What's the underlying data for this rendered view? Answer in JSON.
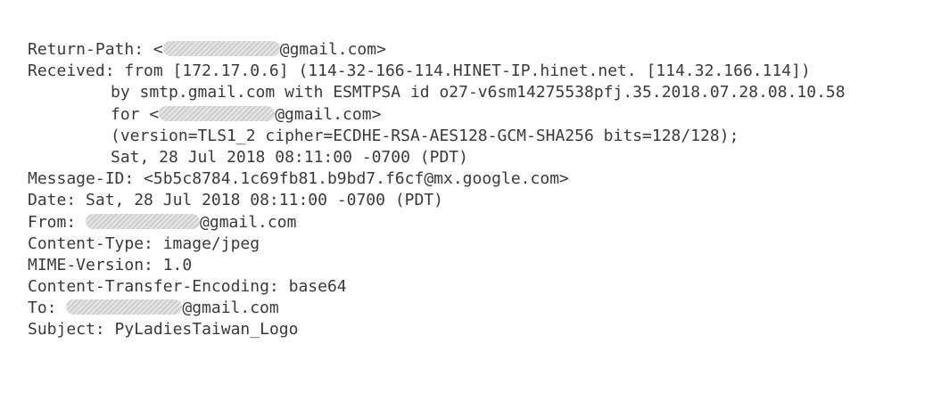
{
  "return_path": {
    "label": "Return-Path: ",
    "open": "<",
    "domain": "@gmail.com",
    "close": ">"
  },
  "received": {
    "label": "Received: ",
    "line1": "from [172.17.0.6] (114-32-166-114.HINET-IP.hinet.net. [114.32.166.114])",
    "line2": "by smtp.gmail.com with ESMTPSA id o27-v6sm14275538pfj.35.2018.07.28.08.10.58",
    "line3_prefix": "for ",
    "line3_open": "<",
    "line3_domain": "@gmail.com",
    "line3_close": ">",
    "line4": "(version=TLS1_2 cipher=ECDHE-RSA-AES128-GCM-SHA256 bits=128/128);",
    "line5": "Sat, 28 Jul 2018 08:11:00 -0700 (PDT)"
  },
  "message_id": {
    "label": "Message-ID: ",
    "value": "<5b5c8784.1c69fb81.b9bd7.f6cf@mx.google.com>"
  },
  "date": {
    "label": "Date: ",
    "value": "Sat, 28 Jul 2018 08:11:00 -0700 (PDT)"
  },
  "from": {
    "label": "From: ",
    "domain": "@gmail.com"
  },
  "content_type": {
    "label": "Content-Type: ",
    "value": "image/jpeg"
  },
  "mime_version": {
    "label": "MIME-Version: ",
    "value": "1.0"
  },
  "content_transfer_encoding": {
    "label": "Content-Transfer-Encoding: ",
    "value": "base64"
  },
  "to": {
    "label": "To: ",
    "domain": "@gmail.com"
  },
  "subject": {
    "label": "Subject: ",
    "value": "PyLadiesTaiwan_Logo"
  }
}
